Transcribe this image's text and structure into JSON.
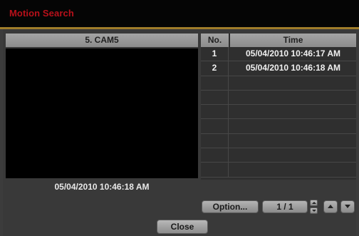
{
  "window": {
    "title": "Motion Search"
  },
  "camera": {
    "label": "5. CAM5",
    "timestamp": "05/04/2010  10:46:18 AM"
  },
  "event_list": {
    "columns": {
      "no": "No.",
      "time": "Time"
    },
    "rows": [
      {
        "no": "1",
        "time": "05/04/2010  10:46:17 AM"
      },
      {
        "no": "2",
        "time": "05/04/2010  10:46:18 AM"
      },
      {
        "no": "",
        "time": ""
      },
      {
        "no": "",
        "time": ""
      },
      {
        "no": "",
        "time": ""
      },
      {
        "no": "",
        "time": ""
      },
      {
        "no": "",
        "time": ""
      },
      {
        "no": "",
        "time": ""
      },
      {
        "no": "",
        "time": ""
      }
    ]
  },
  "controls": {
    "option_label": "Option...",
    "page_label": "1 / 1",
    "close_label": "Close"
  },
  "colors": {
    "title": "#b8101a",
    "title_underline": "#a07d2a",
    "background": "#3c3c3c"
  },
  "icons": {
    "page_spinner_up": "spinner-up-icon",
    "page_spinner_down": "spinner-down-icon",
    "scroll_up": "triangle-up-icon",
    "scroll_down": "triangle-down-icon"
  }
}
